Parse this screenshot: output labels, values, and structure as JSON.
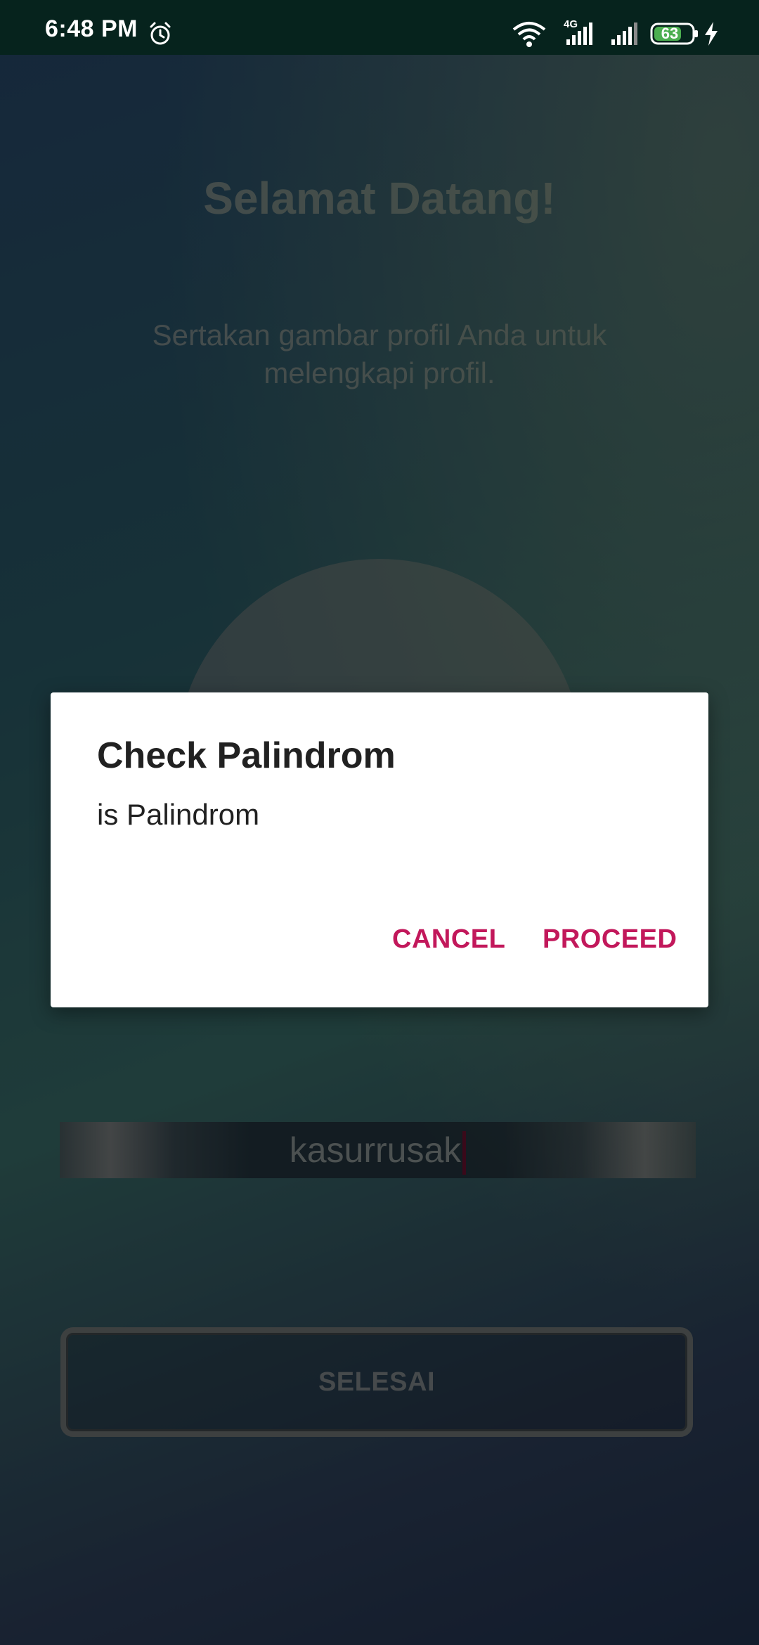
{
  "status_bar": {
    "time": "6:48 PM",
    "network_type": "4G",
    "battery_level": "63",
    "icons": [
      "alarm-icon",
      "wifi-icon",
      "signal-icon",
      "battery-icon",
      "charging-icon"
    ]
  },
  "screen": {
    "title": "Selamat Datang!",
    "subtitle": "Sertakan gambar profil Anda untuk melengkapi profil.",
    "name_input_value": "kasurrusak",
    "done_button_label": "SELESAI"
  },
  "dialog": {
    "title": "Check Palindrom",
    "message": "is Palindrom",
    "cancel_label": "CANCEL",
    "proceed_label": "PROCEED",
    "accent_color": "#c2185b"
  }
}
